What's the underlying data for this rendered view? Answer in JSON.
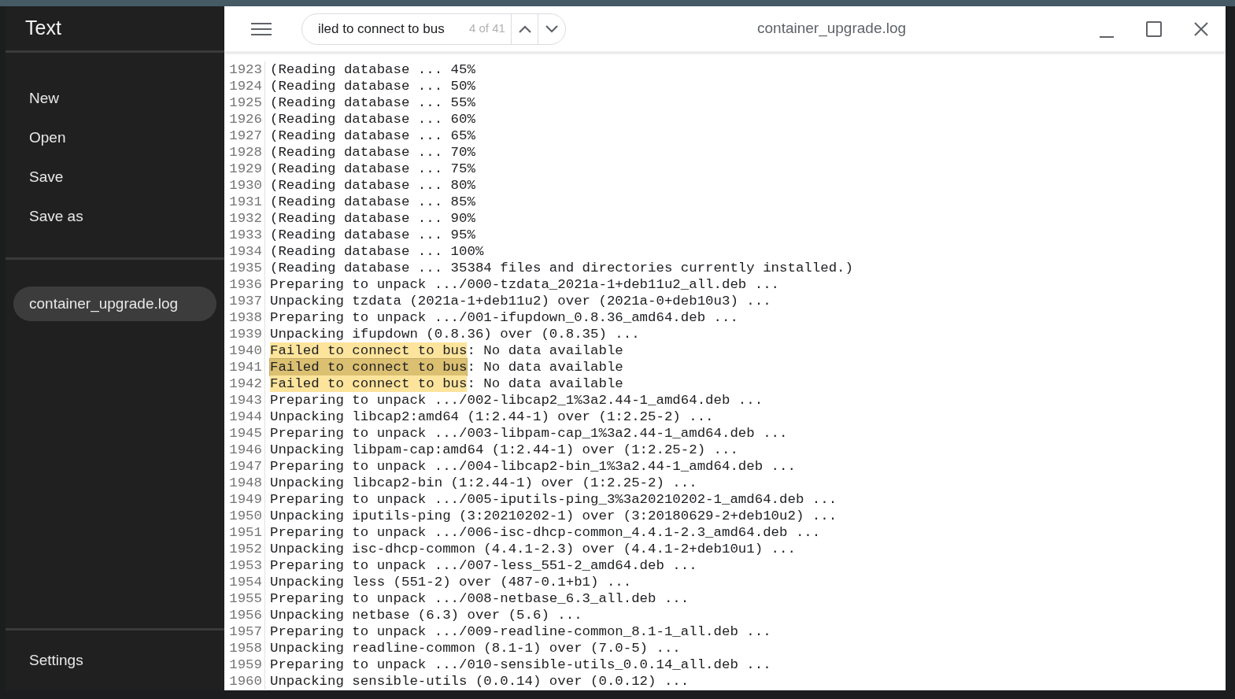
{
  "sidebar": {
    "title": "Text",
    "menu": [
      "New",
      "Open",
      "Save",
      "Save as"
    ],
    "files": [
      {
        "name": "container_upgrade.log",
        "selected": true
      }
    ],
    "settings": "Settings"
  },
  "toolbar": {
    "search": {
      "value": "iled to connect to bus",
      "count": "4 of 41"
    },
    "title": "container_upgrade.log"
  },
  "lines": [
    {
      "number": "1923",
      "text": "(Reading database ... 45%"
    },
    {
      "number": "1924",
      "text": "(Reading database ... 50%"
    },
    {
      "number": "1925",
      "text": "(Reading database ... 55%"
    },
    {
      "number": "1926",
      "text": "(Reading database ... 60%"
    },
    {
      "number": "1927",
      "text": "(Reading database ... 65%"
    },
    {
      "number": "1928",
      "text": "(Reading database ... 70%"
    },
    {
      "number": "1929",
      "text": "(Reading database ... 75%"
    },
    {
      "number": "1930",
      "text": "(Reading database ... 80%"
    },
    {
      "number": "1931",
      "text": "(Reading database ... 85%"
    },
    {
      "number": "1932",
      "text": "(Reading database ... 90%"
    },
    {
      "number": "1933",
      "text": "(Reading database ... 95%"
    },
    {
      "number": "1934",
      "text": "(Reading database ... 100%"
    },
    {
      "number": "1935",
      "text": "(Reading database ... 35384 files and directories currently installed.)"
    },
    {
      "number": "1936",
      "text": "Preparing to unpack .../000-tzdata_2021a-1+deb11u2_all.deb ..."
    },
    {
      "number": "1937",
      "text": "Unpacking tzdata (2021a-1+deb11u2) over (2021a-0+deb10u3) ..."
    },
    {
      "number": "1938",
      "text": "Preparing to unpack .../001-ifupdown_0.8.36_amd64.deb ..."
    },
    {
      "number": "1939",
      "text": "Unpacking ifupdown (0.8.36) over (0.8.35) ..."
    },
    {
      "number": "1940",
      "match": {
        "text": "Failed to connect to bus",
        "current": false
      },
      "text": ": No data available"
    },
    {
      "number": "1941",
      "match": {
        "text": "Failed to connect to bus",
        "current": true
      },
      "text": ": No data available"
    },
    {
      "number": "1942",
      "match": {
        "text": "Failed to connect to bus",
        "current": false
      },
      "text": ": No data available"
    },
    {
      "number": "1943",
      "text": "Preparing to unpack .../002-libcap2_1%3a2.44-1_amd64.deb ..."
    },
    {
      "number": "1944",
      "text": "Unpacking libcap2:amd64 (1:2.44-1) over (1:2.25-2) ..."
    },
    {
      "number": "1945",
      "text": "Preparing to unpack .../003-libpam-cap_1%3a2.44-1_amd64.deb ..."
    },
    {
      "number": "1946",
      "text": "Unpacking libpam-cap:amd64 (1:2.44-1) over (1:2.25-2) ..."
    },
    {
      "number": "1947",
      "text": "Preparing to unpack .../004-libcap2-bin_1%3a2.44-1_amd64.deb ..."
    },
    {
      "number": "1948",
      "text": "Unpacking libcap2-bin (1:2.44-1) over (1:2.25-2) ..."
    },
    {
      "number": "1949",
      "text": "Preparing to unpack .../005-iputils-ping_3%3a20210202-1_amd64.deb ..."
    },
    {
      "number": "1950",
      "text": "Unpacking iputils-ping (3:20210202-1) over (3:20180629-2+deb10u2) ..."
    },
    {
      "number": "1951",
      "text": "Preparing to unpack .../006-isc-dhcp-common_4.4.1-2.3_amd64.deb ..."
    },
    {
      "number": "1952",
      "text": "Unpacking isc-dhcp-common (4.4.1-2.3) over (4.4.1-2+deb10u1) ..."
    },
    {
      "number": "1953",
      "text": "Preparing to unpack .../007-less_551-2_amd64.deb ..."
    },
    {
      "number": "1954",
      "text": "Unpacking less (551-2) over (487-0.1+b1) ..."
    },
    {
      "number": "1955",
      "text": "Preparing to unpack .../008-netbase_6.3_all.deb ..."
    },
    {
      "number": "1956",
      "text": "Unpacking netbase (6.3) over (5.6) ..."
    },
    {
      "number": "1957",
      "text": "Preparing to unpack .../009-readline-common_8.1-1_all.deb ..."
    },
    {
      "number": "1958",
      "text": "Unpacking readline-common (8.1-1) over (7.0-5) ..."
    },
    {
      "number": "1959",
      "text": "Preparing to unpack .../010-sensible-utils_0.0.14_all.deb ..."
    },
    {
      "number": "1960",
      "text": "Unpacking sensible-utils (0.0.14) over (0.0.12) ..."
    }
  ]
}
